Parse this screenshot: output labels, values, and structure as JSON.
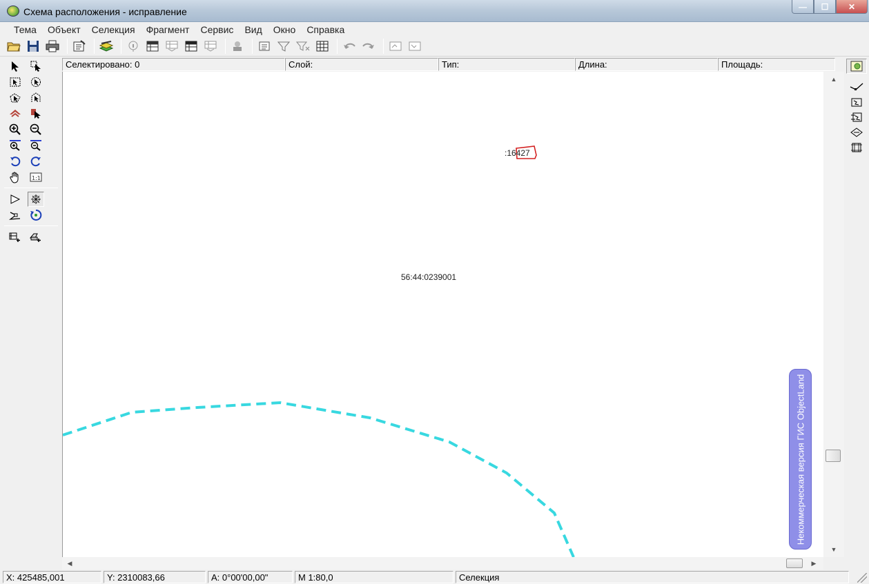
{
  "window": {
    "title": "Схема расположения - исправление",
    "controls": {
      "minimize": "—",
      "maximize": "☐",
      "close": "✕"
    }
  },
  "menu": [
    "Тема",
    "Объект",
    "Селекция",
    "Фрагмент",
    "Сервис",
    "Вид",
    "Окно",
    "Справка"
  ],
  "toolbar": {
    "icons": [
      "open-folder-icon",
      "save-icon",
      "print-icon",
      "properties-icon",
      "layers-icon",
      "info-icon",
      "table-icon",
      "table-grey-icon",
      "table-dark-icon",
      "table-grey2-icon",
      "layer-object-icon",
      "list-icon",
      "filter-icon",
      "filter-clear-icon",
      "grid-icon",
      "undo-icon",
      "redo-icon",
      "window-icon",
      "window-alt-icon"
    ]
  },
  "info_bar": {
    "selected": "Селектировано: 0",
    "layer": "Слой:",
    "type": "Тип:",
    "length": "Длина:",
    "area": "Площадь:"
  },
  "map": {
    "labels": {
      "parcel_number": ":16427",
      "cadastral_block": "56:44:0239001"
    },
    "colors": {
      "boundary": "#38d8e0",
      "parcel": "#d32020"
    },
    "banner": "Некоммерческая версия ГИС ObjectLand"
  },
  "status": {
    "x": "X: 425485,001",
    "y": "Y: 2310083,66",
    "angle": "A:   0°00'00,00\"",
    "scale": "M 1:80,0",
    "mode": "Селекция"
  }
}
